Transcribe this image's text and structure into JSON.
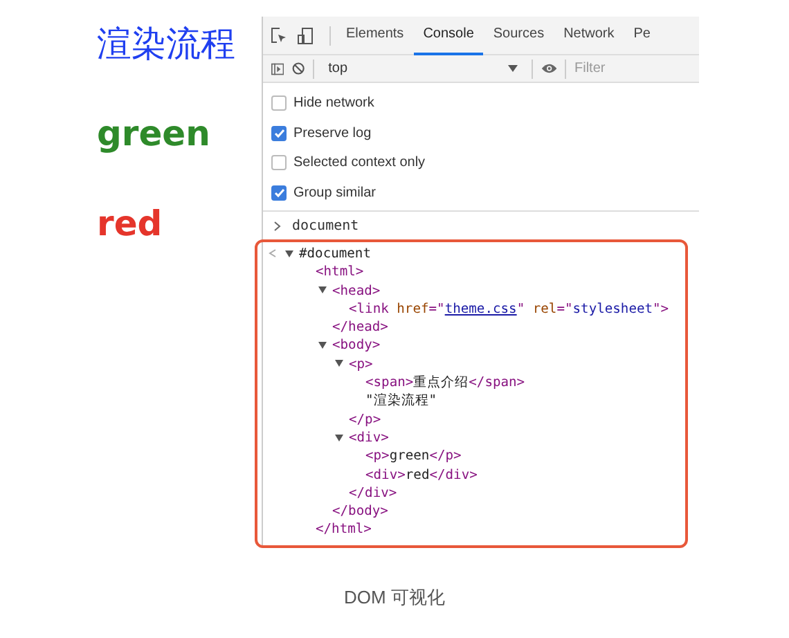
{
  "headings": [
    {
      "text": "渲染流程",
      "color": "#1f3ff0"
    },
    {
      "text": "green",
      "color": "#2e8a2a"
    },
    {
      "text": "red",
      "color": "#e5352b"
    }
  ],
  "devtools": {
    "tabs": [
      {
        "label": "Elements",
        "selected": false
      },
      {
        "label": "Console",
        "selected": true
      },
      {
        "label": "Sources",
        "selected": false
      },
      {
        "label": "Network",
        "selected": false
      },
      {
        "label": "Pe",
        "selected": false
      }
    ],
    "context": "top",
    "filter": {
      "placeholder": "Filter"
    },
    "options": [
      {
        "label": "Hide network",
        "checked": false
      },
      {
        "label": "Preserve log",
        "checked": true
      },
      {
        "label": "Selected context only",
        "checked": false
      },
      {
        "label": "Group similar",
        "checked": true
      }
    ],
    "prompt": "document",
    "result": {
      "tokens": [
        {
          "kind": "text",
          "text": "#document"
        }
      ],
      "expanded": true,
      "children": [
        {
          "tokens": [
            {
              "kind": "tag",
              "text": "<html>"
            }
          ],
          "children": [
            {
              "tokens": [
                {
                  "kind": "tag",
                  "text": "<head>"
                }
              ],
              "expanded": true,
              "children": [
                {
                  "tokens": [
                    {
                      "kind": "tag",
                      "text": "<link "
                    },
                    {
                      "kind": "attr",
                      "text": "href"
                    },
                    {
                      "kind": "tag",
                      "text": "=\""
                    },
                    {
                      "kind": "link",
                      "text": "theme.css"
                    },
                    {
                      "kind": "tag",
                      "text": "\" "
                    },
                    {
                      "kind": "attr",
                      "text": "rel"
                    },
                    {
                      "kind": "tag",
                      "text": "=\""
                    },
                    {
                      "kind": "value",
                      "text": "stylesheet"
                    },
                    {
                      "kind": "tag",
                      "text": "\">"
                    }
                  ]
                }
              ],
              "close": [
                {
                  "kind": "tag",
                  "text": "</head>"
                }
              ]
            },
            {
              "tokens": [
                {
                  "kind": "tag",
                  "text": "<body>"
                }
              ],
              "expanded": true,
              "children": [
                {
                  "tokens": [
                    {
                      "kind": "tag",
                      "text": "<p>"
                    }
                  ],
                  "expanded": true,
                  "children": [
                    {
                      "tokens": [
                        {
                          "kind": "tag",
                          "text": "<span>"
                        },
                        {
                          "kind": "text",
                          "text": "重点介绍"
                        },
                        {
                          "kind": "tag",
                          "text": "</span>"
                        }
                      ]
                    },
                    {
                      "tokens": [
                        {
                          "kind": "text",
                          "text": "\"渲染流程\""
                        }
                      ]
                    }
                  ],
                  "close": [
                    {
                      "kind": "tag",
                      "text": "</p>"
                    }
                  ]
                },
                {
                  "tokens": [
                    {
                      "kind": "tag",
                      "text": "<div>"
                    }
                  ],
                  "expanded": true,
                  "children": [
                    {
                      "tokens": [
                        {
                          "kind": "tag",
                          "text": "<p>"
                        },
                        {
                          "kind": "text",
                          "text": "green"
                        },
                        {
                          "kind": "tag",
                          "text": "</p>"
                        }
                      ]
                    },
                    {
                      "tokens": [
                        {
                          "kind": "tag",
                          "text": "<div>"
                        },
                        {
                          "kind": "text",
                          "text": "red"
                        },
                        {
                          "kind": "tag",
                          "text": "</div>"
                        }
                      ]
                    }
                  ],
                  "close": [
                    {
                      "kind": "tag",
                      "text": "</div>"
                    }
                  ]
                }
              ],
              "close": [
                {
                  "kind": "tag",
                  "text": "</body>"
                }
              ]
            }
          ],
          "close": [
            {
              "kind": "tag",
              "text": "</html>"
            }
          ]
        }
      ]
    }
  },
  "caption": "DOM 可视化"
}
